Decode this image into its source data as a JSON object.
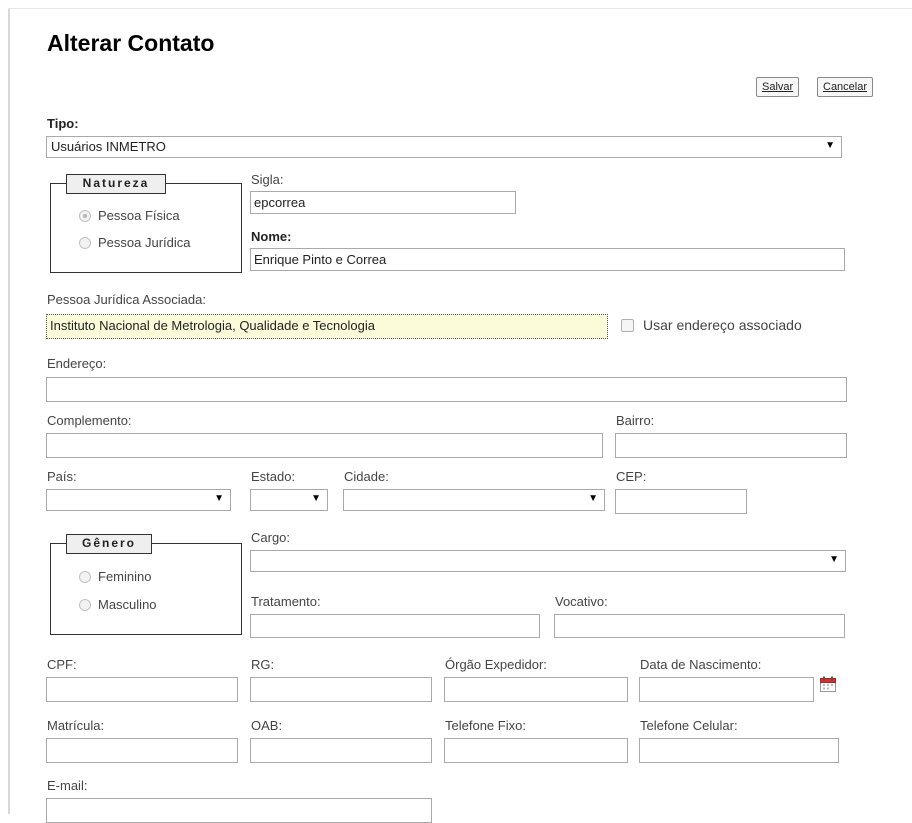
{
  "page": {
    "title": "Alterar Contato"
  },
  "toolbar": {
    "save_label": "Salvar",
    "cancel_label": "Cancelar"
  },
  "tipo": {
    "label": "Tipo:",
    "value": "Usuários INMETRO"
  },
  "natureza": {
    "legend": "Natureza",
    "options": [
      "Pessoa Física",
      "Pessoa Jurídica"
    ],
    "selected": "Pessoa Física"
  },
  "sigla": {
    "label": "Sigla:",
    "value": "epcorrea"
  },
  "nome": {
    "label": "Nome:",
    "value": "Enrique Pinto e Correa"
  },
  "pj_associada": {
    "label": "Pessoa Jurídica Associada:",
    "value": "Instituto Nacional de Metrologia, Qualidade e Tecnologia"
  },
  "usar_endereco": {
    "label": "Usar endereço associado",
    "checked": false
  },
  "endereco": {
    "label": "Endereço:",
    "value": ""
  },
  "complemento": {
    "label": "Complemento:",
    "value": ""
  },
  "bairro": {
    "label": "Bairro:",
    "value": ""
  },
  "pais": {
    "label": "País:",
    "value": ""
  },
  "estado": {
    "label": "Estado:",
    "value": ""
  },
  "cidade": {
    "label": "Cidade:",
    "value": ""
  },
  "cep": {
    "label": "CEP:",
    "value": ""
  },
  "genero": {
    "legend": "Gênero",
    "options": [
      "Feminino",
      "Masculino"
    ],
    "selected": null
  },
  "cargo": {
    "label": "Cargo:",
    "value": ""
  },
  "tratamento": {
    "label": "Tratamento:",
    "value": ""
  },
  "vocativo": {
    "label": "Vocativo:",
    "value": ""
  },
  "cpf": {
    "label": "CPF:",
    "value": ""
  },
  "rg": {
    "label": "RG:",
    "value": ""
  },
  "orgao": {
    "label": "Órgão Expedidor:",
    "value": ""
  },
  "nascimento": {
    "label": "Data de Nascimento:",
    "value": ""
  },
  "matricula": {
    "label": "Matrícula:",
    "value": ""
  },
  "oab": {
    "label": "OAB:",
    "value": ""
  },
  "tel_fixo": {
    "label": "Telefone Fixo:",
    "value": ""
  },
  "tel_celular": {
    "label": "Telefone Celular:",
    "value": ""
  },
  "email": {
    "label": "E-mail:",
    "value": ""
  },
  "icons": {
    "calendar": "calendar-icon",
    "dropdown": "chevron-down-icon"
  }
}
